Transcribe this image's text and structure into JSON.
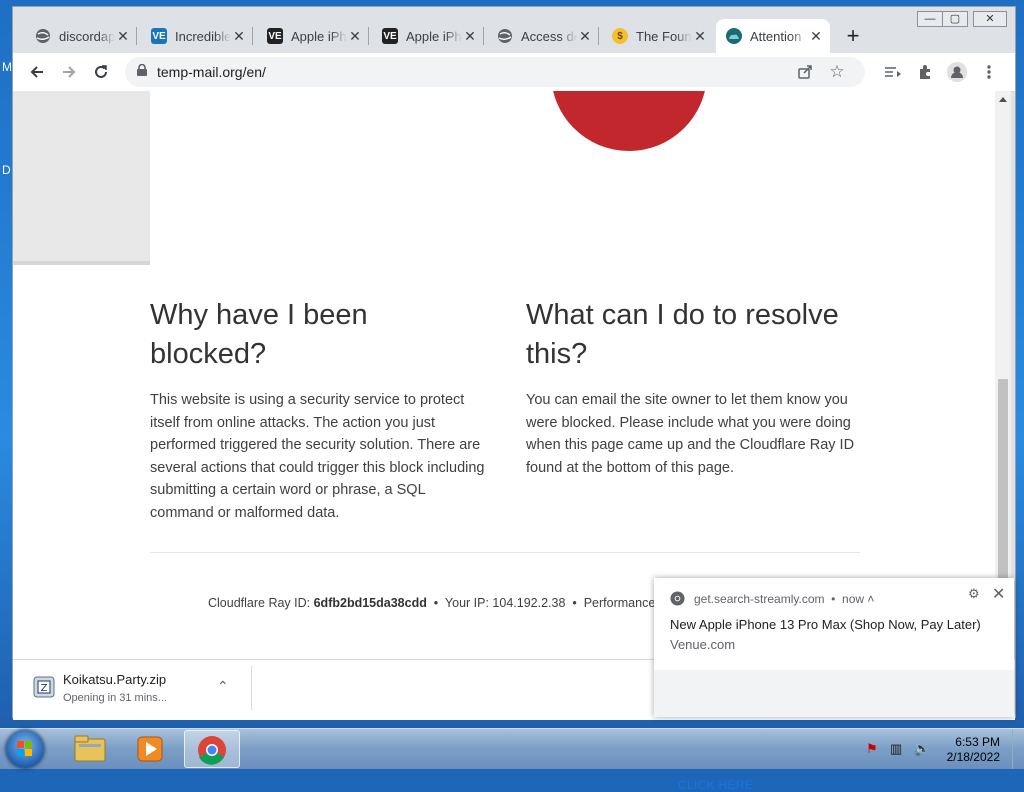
{
  "desktop": {
    "letters": [
      "M",
      "D"
    ]
  },
  "browser": {
    "tabs": [
      {
        "label": "discordap",
        "icon": "globe-icon"
      },
      {
        "label": "Incredible",
        "icon": "ve-logo-icon"
      },
      {
        "label": "Apple iPh",
        "icon": "ve-logo-icon"
      },
      {
        "label": "Apple iPh",
        "icon": "ve-logo-icon"
      },
      {
        "label": "Access de",
        "icon": "globe-icon"
      },
      {
        "label": "The Foun",
        "icon": "foundation-icon"
      },
      {
        "label": "Attention",
        "icon": "cloudflare-icon",
        "active": true
      }
    ],
    "url": "temp-mail.org/en/"
  },
  "page": {
    "why_heading": "Why have I been blocked?",
    "why_text": "This website is using a security service to protect itself from online attacks. The action you just performed triggered the security solution. There are several actions that could trigger this block including submitting a certain word or phrase, a SQL command or malformed data.",
    "what_heading": "What can I do to resolve this?",
    "what_text": "You can email the site owner to let them know you were blocked. Please include what you were doing when this page came up and the Cloudflare Ray ID found at the bottom of this page.",
    "footer": {
      "ray_label": "Cloudflare Ray ID:",
      "ray_id": "6dfb2bd15da38cdd",
      "bullet": "•",
      "ip_label": "Your IP:",
      "ip": "104.192.2.38",
      "perf": "Performance"
    },
    "accent_color": "#c1272d"
  },
  "download": {
    "filename": "Koikatsu.Party.zip",
    "status": "Opening in 31 mins..."
  },
  "notification": {
    "site": "get.search-streamly.com",
    "time": "now",
    "title": "New Apple iPhone 13 Pro Max (Shop Now, Pay Later)",
    "body": "Venue.com",
    "action": "CLICK HERE"
  },
  "taskbar": {
    "time": "6:53 PM",
    "date": "2/18/2022"
  }
}
